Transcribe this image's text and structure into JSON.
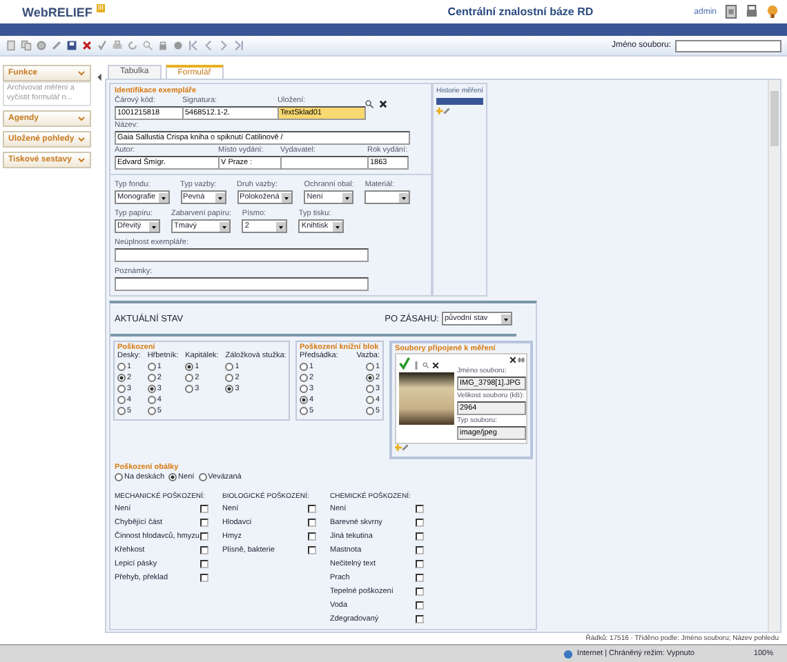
{
  "header": {
    "logo": "WebRELIEF",
    "logo_badge": "III",
    "title": "Centrální znalostní báze RD",
    "user": "admin"
  },
  "toolbar": {
    "file_label": "Jméno souboru:"
  },
  "sidebar": {
    "panels": [
      {
        "title": "Funkce",
        "text": "Archivovat měření a vyčistit formulář n..."
      },
      {
        "title": "Agendy"
      },
      {
        "title": "Uložené pohledy"
      },
      {
        "title": "Tiskové sestavy"
      }
    ]
  },
  "tabs": [
    {
      "label": "Tabulka",
      "selected": false
    },
    {
      "label": "Formulář",
      "selected": true
    }
  ],
  "identification": {
    "title": "Identifikace exempláře",
    "row1": [
      {
        "label": "Čárový kód:",
        "value": "1001215818",
        "highlighted": false
      },
      {
        "label": "Signatura:",
        "value": "5468512.1-2.",
        "highlighted": false
      },
      {
        "label": "Uložení:",
        "value": "TextSklad01",
        "highlighted": true
      }
    ],
    "name": {
      "label": "Název:",
      "value": "Gaia Sallustia Crispa kniha o spiknutí Catilinově /"
    },
    "row3": [
      {
        "label": "Autor:",
        "value": "Edvard Šmígr."
      },
      {
        "label": "Místo vydání:",
        "value": "V Praze :"
      },
      {
        "label": "Vydavatel:"
      },
      {
        "label": "Rok vydání:",
        "value": "1863"
      }
    ]
  },
  "selects": [
    [
      {
        "label": "Typ fondu:",
        "value": "Monografie"
      },
      {
        "label": "Typ vazby:",
        "value": "Pevná"
      },
      {
        "label": "Druh vazby:",
        "value": "Polokožená"
      },
      {
        "label": "Ochranní obal:",
        "value": "Není"
      },
      {
        "label": "Materiál:"
      }
    ],
    [
      {
        "label": "Typ papíru:",
        "value": "Dřevitý"
      },
      {
        "label": "Zabarvení papíru:",
        "value": "Tmavý"
      },
      {
        "label": "Písmo:",
        "value": "2"
      },
      {
        "label": "Typ tisku:",
        "value": "Knihtisk"
      }
    ]
  ],
  "notes": [
    {
      "label": "Neúplnost exempláře:"
    },
    {
      "label": "Poznámky:"
    }
  ],
  "history": {
    "title": "Historie měření"
  },
  "state": {
    "current_label": "AKTUÁLNÍ STAV",
    "after_label": "PO ZÁSAHU:",
    "after_value": "původní stav"
  },
  "damage": {
    "title": "Poškození",
    "groups": [
      {
        "label": "Desky:",
        "options": [
          {
            "label": "1",
            "selected": false
          },
          {
            "label": "2",
            "selected": true
          },
          {
            "label": "3",
            "selected": false
          },
          {
            "label": "4",
            "selected": false
          },
          {
            "label": "5",
            "selected": false
          }
        ]
      },
      {
        "label": "Hřbetník:",
        "options": [
          {
            "label": "1",
            "selected": false
          },
          {
            "label": "2",
            "selected": false
          },
          {
            "label": "3",
            "selected": true
          },
          {
            "label": "4",
            "selected": false
          },
          {
            "label": "5",
            "selected": false
          }
        ]
      },
      {
        "label": "Kapitálek:",
        "options": [
          {
            "label": "1",
            "selected": true
          },
          {
            "label": "2",
            "selected": false
          },
          {
            "label": "3",
            "selected": false
          }
        ]
      },
      {
        "label": "Záložková stužka:",
        "options": [
          {
            "label": "1",
            "selected": false
          },
          {
            "label": "2",
            "selected": false
          },
          {
            "label": "3",
            "selected": true
          }
        ]
      }
    ]
  },
  "block_damage": {
    "title": "Poškození knižní blok",
    "groups": [
      {
        "label": "Předsádka:",
        "options": [
          {
            "label": "1",
            "selected": false
          },
          {
            "label": "2",
            "selected": false
          },
          {
            "label": "3",
            "selected": false
          },
          {
            "label": "4",
            "selected": true
          },
          {
            "label": "5",
            "selected": false
          }
        ]
      },
      {
        "label": "Vazba:",
        "options": [
          {
            "label": "1",
            "selected": false
          },
          {
            "label": "2",
            "selected": true
          },
          {
            "label": "3",
            "selected": false
          },
          {
            "label": "4",
            "selected": false
          },
          {
            "label": "5",
            "selected": false
          }
        ]
      }
    ]
  },
  "files": {
    "title": "Soubory připojené k měření",
    "fields": [
      {
        "label": "Jméno souboru:",
        "value": "IMG_3798[1].JPG"
      },
      {
        "label": "Velikost souboru (kB):",
        "value": "2964"
      },
      {
        "label": "Typ souboru:",
        "value": "image/jpeg"
      }
    ]
  },
  "cover": {
    "title": "Poškození obálky",
    "options": [
      {
        "label": "Na deskách",
        "selected": false
      },
      {
        "label": "Není",
        "selected": true
      },
      {
        "label": "Vevázaná",
        "selected": false
      }
    ]
  },
  "checklists": [
    {
      "title": "MECHANICKÉ POŠKOZENÍ:",
      "items": [
        {
          "label": "Není",
          "checked": false
        },
        {
          "label": "Chybějící část",
          "checked": false
        },
        {
          "label": "Činnost hlodavců, hmyzu",
          "checked": false
        },
        {
          "label": "Křehkost",
          "checked": false
        },
        {
          "label": "Lepicí pásky",
          "checked": false
        },
        {
          "label": "Přehyb, překlad",
          "checked": false
        }
      ]
    },
    {
      "title": "BIOLOGICKÉ POŠKOZENÍ:",
      "items": [
        {
          "label": "Není",
          "checked": false
        },
        {
          "label": "Hlodavci",
          "checked": false
        },
        {
          "label": "Hmyz",
          "checked": false
        },
        {
          "label": "Plísně, bakterie",
          "checked": false
        }
      ]
    },
    {
      "title": "CHEMICKÉ POŠKOZENÍ:",
      "items": [
        {
          "label": "Není",
          "checked": false
        },
        {
          "label": "Barevné skvrny",
          "checked": false
        },
        {
          "label": "Jiná tekutina",
          "checked": false
        },
        {
          "label": "Mastnota",
          "checked": false
        },
        {
          "label": "Nečitelný text",
          "checked": false
        },
        {
          "label": "Prach",
          "checked": false
        },
        {
          "label": "Tepelné poškození",
          "checked": false
        },
        {
          "label": "Voda",
          "checked": false
        },
        {
          "label": "Zdegradovaný",
          "checked": false
        }
      ]
    }
  ],
  "footer": {
    "info": "Řádků: 17516 · Tříděno podle: Jméno souboru; Název pohledu"
  },
  "browser_status": {
    "zone": "Internet | Chráněný režim: Vypnuto",
    "zoom": "100%"
  }
}
